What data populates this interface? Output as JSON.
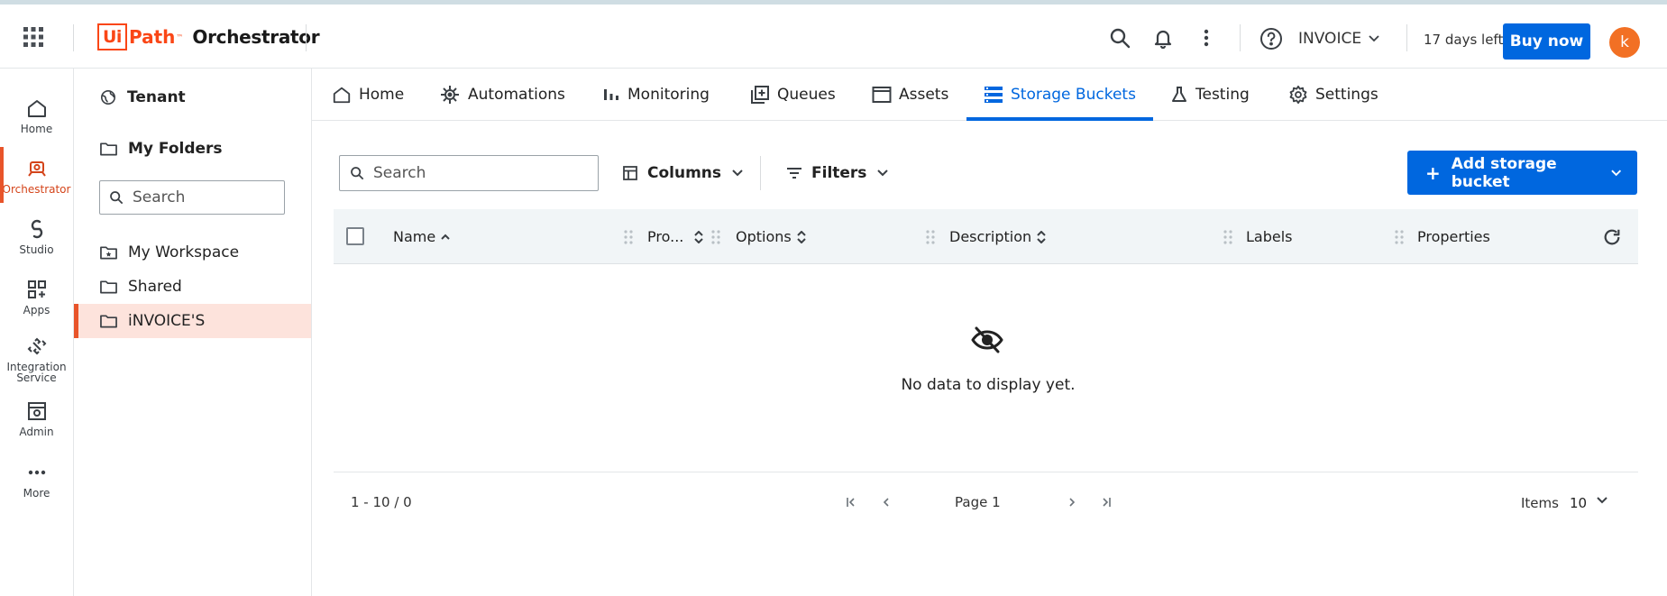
{
  "header": {
    "logo_brand": "Ui",
    "logo_brand_path": "Path",
    "logo_tm": "™",
    "product": "Orchestrator",
    "tenant": "INVOICE",
    "trial": "17 days left",
    "buy_label": "Buy now",
    "avatar_letter": "k",
    "accent": "#fa4616",
    "primary": "#0067df"
  },
  "rail": {
    "items": [
      {
        "label": "Home",
        "icon": "home-icon"
      },
      {
        "label": "Orchestrator",
        "icon": "orchestrator-icon"
      },
      {
        "label": "Studio",
        "icon": "studio-icon"
      },
      {
        "label": "Apps",
        "icon": "apps-icon"
      },
      {
        "label": "Integration Service",
        "icon": "integration-icon"
      },
      {
        "label": "Admin",
        "icon": "admin-icon"
      },
      {
        "label": "More",
        "icon": "more-icon"
      }
    ],
    "active": "Orchestrator"
  },
  "folders": {
    "tenant_label": "Tenant",
    "my_folders_label": "My Folders",
    "search_placeholder": "Search",
    "items": [
      {
        "label": "My Workspace",
        "icon": "workspace-folder-icon"
      },
      {
        "label": "Shared",
        "icon": "folder-icon"
      },
      {
        "label": "iNVOICE'S",
        "icon": "folder-icon"
      }
    ],
    "selected": "iNVOICE'S"
  },
  "tabs": [
    {
      "label": "Home",
      "icon": "home-icon"
    },
    {
      "label": "Automations",
      "icon": "automations-icon"
    },
    {
      "label": "Monitoring",
      "icon": "monitoring-icon"
    },
    {
      "label": "Queues",
      "icon": "queues-icon"
    },
    {
      "label": "Assets",
      "icon": "assets-icon"
    },
    {
      "label": "Storage Buckets",
      "icon": "storage-buckets-icon"
    },
    {
      "label": "Testing",
      "icon": "testing-icon"
    },
    {
      "label": "Settings",
      "icon": "settings-icon"
    }
  ],
  "active_tab": "Storage Buckets",
  "toolbar": {
    "search_placeholder": "Search",
    "columns_label": "Columns",
    "filters_label": "Filters",
    "add_label": "Add storage bucket"
  },
  "table": {
    "columns": [
      "Name",
      "Pro...",
      "Options",
      "Description",
      "Labels",
      "Properties"
    ],
    "empty_text": "No data to display yet."
  },
  "pager": {
    "range": "1 - 10 / 0",
    "page_label": "Page 1",
    "items_label": "Items",
    "items_value": "10"
  }
}
